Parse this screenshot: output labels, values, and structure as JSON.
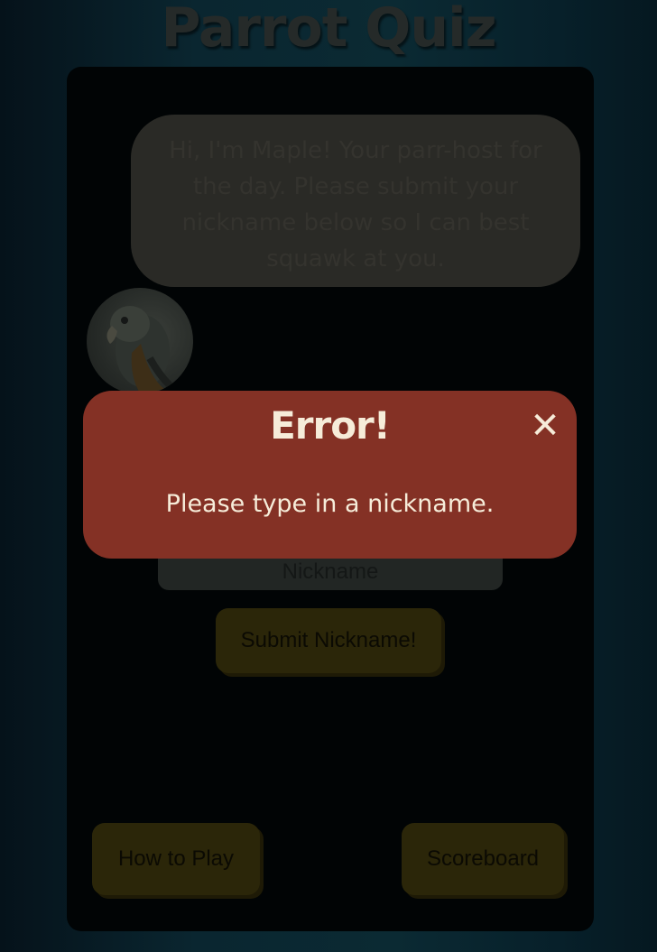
{
  "page": {
    "title": "Parrot Quiz"
  },
  "host": {
    "message": "Hi, I'm Maple! Your parr-host for the day. Please submit your nickname below so I can best squawk at you.",
    "avatar_icon": "parrot-avatar"
  },
  "form": {
    "nickname_placeholder": "Nickname",
    "nickname_value": "",
    "submit_label": "Submit Nickname!"
  },
  "footer": {
    "how_to_play_label": "How to Play",
    "scoreboard_label": "Scoreboard"
  },
  "modal": {
    "title": "Error!",
    "close_symbol": "✕",
    "message": "Please type in a nickname."
  },
  "colors": {
    "modal_background": "#843125",
    "modal_text": "#f6ecd9",
    "button_background": "#2b2609",
    "card_background": "#010405"
  }
}
